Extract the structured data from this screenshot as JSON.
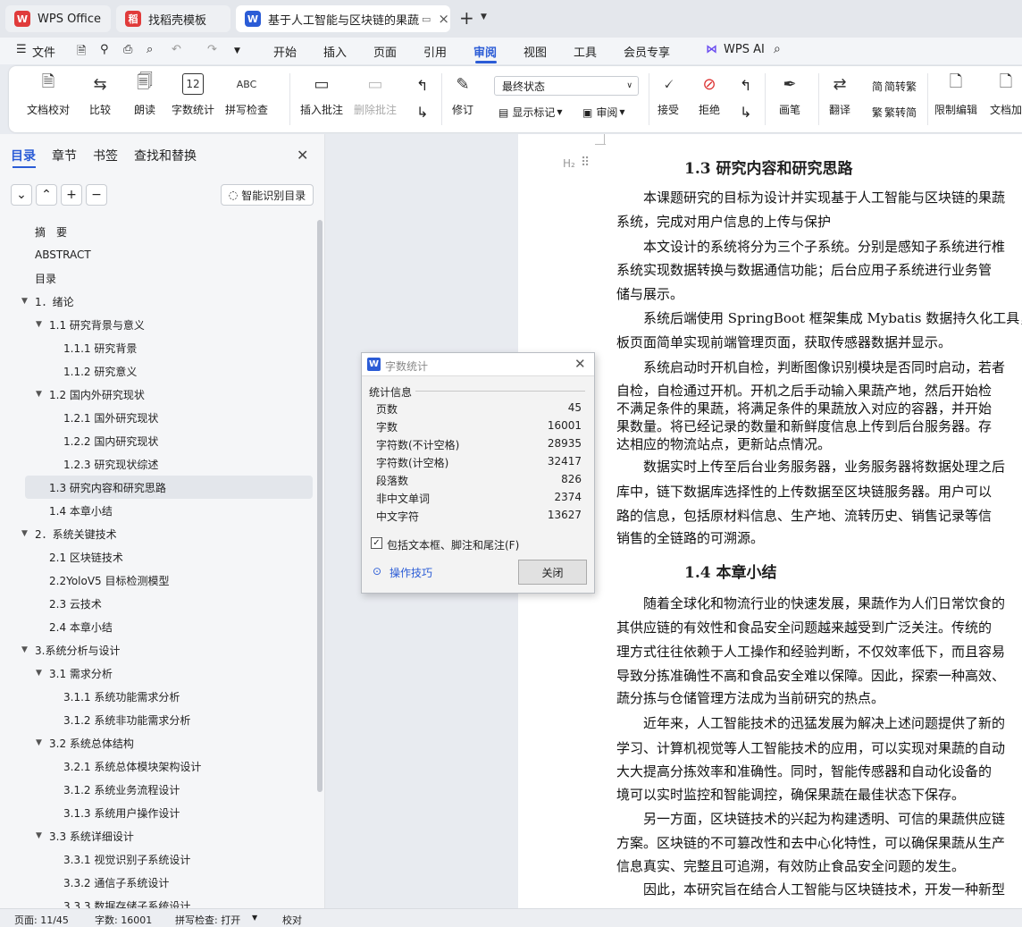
{
  "tabs": [
    {
      "label": "WPS Office"
    },
    {
      "label": "找稻壳模板"
    },
    {
      "label": "基于人工智能与区块链的果蔬"
    }
  ],
  "menu": {
    "file": "文件",
    "items": [
      "开始",
      "插入",
      "页面",
      "引用",
      "审阅",
      "视图",
      "工具",
      "会员专享"
    ],
    "wps_ai": "WPS AI"
  },
  "ribbon": {
    "doc_check": "文档校对",
    "compare": "比较",
    "read": "朗读",
    "word_count": "字数统计",
    "spell_check": "拼写检查",
    "insert_comment": "插入批注",
    "delete_comment": "删除批注",
    "revise": "修订",
    "final_state": "最终状态",
    "show_marks": "显示标记",
    "review": "审阅",
    "accept": "接受",
    "reject": "拒绝",
    "pen": "画笔",
    "translate": "翻译",
    "to_traditional": "简转繁",
    "to_simplified": "繁转简",
    "restrict_edit": "限制编辑",
    "doc_encrypt": "文档加"
  },
  "sidebar": {
    "tabs": [
      "目录",
      "章节",
      "书签",
      "查找和替换"
    ],
    "smart_btn": "智能识别目录",
    "items": [
      {
        "text": "摘　要",
        "level": 0
      },
      {
        "text": "ABSTRACT",
        "level": 0
      },
      {
        "text": "目录",
        "level": 0
      },
      {
        "text": "1．绪论",
        "level": 0,
        "arrow": true
      },
      {
        "text": "1.1 研究背景与意义",
        "level": 1,
        "arrow": true
      },
      {
        "text": "1.1.1 研究背景",
        "level": 2
      },
      {
        "text": "1.1.2 研究意义",
        "level": 2
      },
      {
        "text": "1.2 国内外研究现状",
        "level": 1,
        "arrow": true
      },
      {
        "text": "1.2.1 国外研究现状",
        "level": 2
      },
      {
        "text": "1.2.2 国内研究现状",
        "level": 2
      },
      {
        "text": "1.2.3 研究现状综述",
        "level": 2
      },
      {
        "text": "1.3 研究内容和研究思路",
        "level": 1,
        "selected": true
      },
      {
        "text": "1.4 本章小结",
        "level": 1
      },
      {
        "text": "2．系统关键技术",
        "level": 0,
        "arrow": true
      },
      {
        "text": "2.1 区块链技术",
        "level": 1
      },
      {
        "text": "2.2YoloV5 目标检测模型",
        "level": 1
      },
      {
        "text": "2.3 云技术",
        "level": 1
      },
      {
        "text": "2.4 本章小结",
        "level": 1
      },
      {
        "text": "3.系统分析与设计",
        "level": 0,
        "arrow": true
      },
      {
        "text": "3.1 需求分析",
        "level": 1,
        "arrow": true
      },
      {
        "text": "3.1.1 系统功能需求分析",
        "level": 2
      },
      {
        "text": "3.1.2 系统非功能需求分析",
        "level": 2
      },
      {
        "text": "3.2 系统总体结构",
        "level": 1,
        "arrow": true
      },
      {
        "text": "3.2.1 系统总体模块架构设计",
        "level": 2
      },
      {
        "text": "3.1.2 系统业务流程设计",
        "level": 2
      },
      {
        "text": "3.1.3 系统用户操作设计",
        "level": 2
      },
      {
        "text": "3.3 系统详细设计",
        "level": 1,
        "arrow": true
      },
      {
        "text": "3.3.1 视觉识别子系统设计",
        "level": 2
      },
      {
        "text": "3.3.2 通信子系统设计",
        "level": 2
      },
      {
        "text": "3.3.3 数据存储子系统设计",
        "level": 2
      }
    ]
  },
  "document": {
    "h1": "1.3 研究内容和研究思路",
    "h2": "1.4 本章小结",
    "lines": [
      "　　本课题研究的目标为设计并实现基于人工智能与区块链的果蔬",
      "系统，完成对用户信息的上传与保护",
      "　　本文设计的系统将分为三个子系统。分别是感知子系统进行椎",
      "系统实现数据转换与数据通信功能；后台应用子系统进行业务管",
      "储与展示。",
      "　　系统后端使用 SpringBoot 框架集成 Mybatis 数据持久化工具，",
      "板页面简单实现前端管理页面，获取传感器数据并显示。",
      "　　系统启动时开机自检，判断图像识别模块是否同时启动，若者",
      "自检，自检通过开机。开机之后手动输入果蔬产地，然后开始检",
      "不满足条件的果蔬，将满足条件的果蔬放入对应的容器，并开始",
      "果数量。将已经记录的数量和新鲜度信息上传到后台服务器。存",
      "达相应的物流站点，更新站点情况。",
      "　　数据实时上传至后台业务服务器，业务服务器将数据处理之后",
      "库中，链下数据库选择性的上传数据至区块链服务器。用户可以",
      "路的信息，包括原材料信息、生产地、流转历史、销售记录等信",
      "销售的全链路的可溯源。",
      "　　随着全球化和物流行业的快速发展，果蔬作为人们日常饮食的",
      "其供应链的有效性和食品安全问题越来越受到广泛关注。传统的",
      "理方式往往依赖于人工操作和经验判断，不仅效率低下，而且容易",
      "导致分拣准确性不高和食品安全难以保障。因此，探索一种高效、",
      "蔬分拣与仓储管理方法成为当前研究的热点。",
      "　　近年来，人工智能技术的迅猛发展为解决上述问题提供了新的",
      "学习、计算机视觉等人工智能技术的应用，可以实现对果蔬的自动",
      "大大提高分拣效率和准确性。同时，智能传感器和自动化设备的",
      "境可以实时监控和智能调控，确保果蔬在最佳状态下保存。",
      "　　另一方面，区块链技术的兴起为构建透明、可信的果蔬供应链",
      "方案。区块链的不可篡改性和去中心化特性，可以确保果蔬从生产",
      "信息真实、完整且可追溯，有效防止食品安全问题的发生。",
      "　　因此，本研究旨在结合人工智能与区块链技术，开发一种新型"
    ]
  },
  "dialog": {
    "title": "字数统计",
    "section": "统计信息",
    "rows": [
      {
        "label": "页数",
        "value": "45"
      },
      {
        "label": "字数",
        "value": "16001"
      },
      {
        "label": "字符数(不计空格)",
        "value": "28935"
      },
      {
        "label": "字符数(计空格)",
        "value": "32417"
      },
      {
        "label": "段落数",
        "value": "826"
      },
      {
        "label": "非中文单词",
        "value": "2374"
      },
      {
        "label": "中文字符",
        "value": "13627"
      }
    ],
    "checkbox": "包括文本框、脚注和尾注(F)",
    "tips": "操作技巧",
    "close": "关闭"
  },
  "status": {
    "page": "页面: 11/45",
    "words": "字数: 16001",
    "spell": "拼写检查: 打开",
    "proof": "校对"
  },
  "colors": {
    "accent": "#2b5cd6",
    "wps_red": "#e03b3b"
  }
}
